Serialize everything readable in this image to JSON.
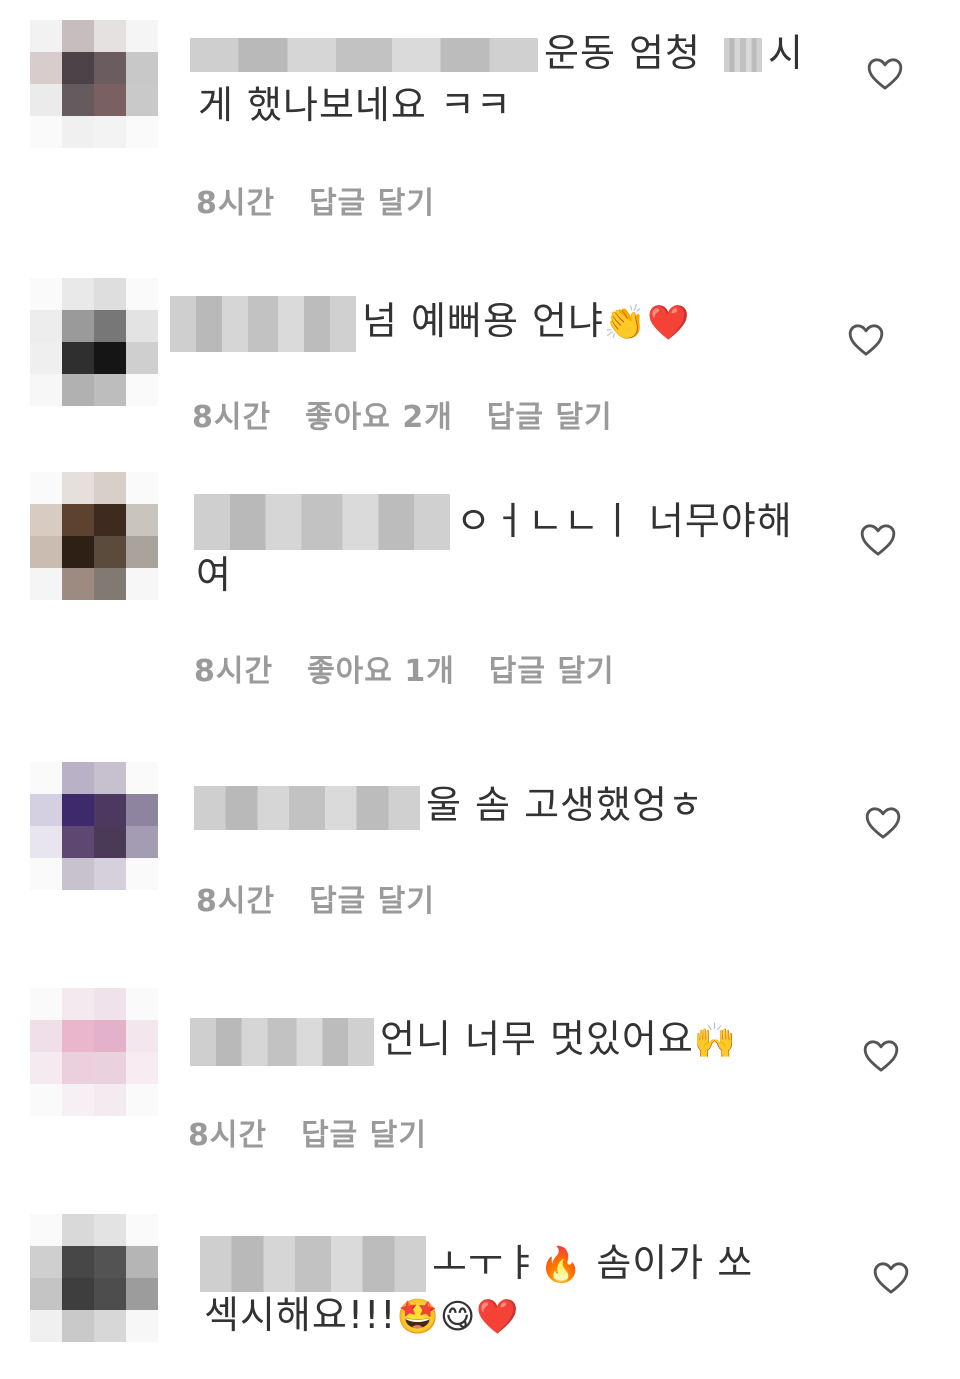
{
  "comments": [
    {
      "text_line1": "운동 엄청",
      "text_line1b": "시",
      "text_line2": "게 했나보네요 ㅋㅋ",
      "time": "8시간",
      "reply": "답글 달기",
      "avatar": [
        "#f2f2f2",
        "#c8bdbe",
        "#e6e1e1",
        "#f5f5f5",
        "#d9cccd",
        "#4d4248",
        "#6a5c5f",
        "#c8c8c8",
        "#ebebeb",
        "#655a5d",
        "#7b6061",
        "#c9c9c9",
        "#fafafa",
        "#f0f0f0",
        "#f3f3f3",
        "#fafafa"
      ]
    },
    {
      "text": "넘 예뻐용 언냐",
      "emojis": "👏❤️",
      "time": "8시간",
      "likes": "좋아요 2개",
      "reply": "답글 달기",
      "avatar": [
        "#fafafa",
        "#e9e9e9",
        "#dedede",
        "#fafafa",
        "#ededed",
        "#9a9a9a",
        "#777777",
        "#e3e3e3",
        "#efefef",
        "#2f2f2f",
        "#151515",
        "#cfcfcf",
        "#f7f7f7",
        "#b1b1b1",
        "#bdbdbd",
        "#fafafa"
      ]
    },
    {
      "text_line1": "ㅇㅓㄴㄴㅣ 너무야해",
      "text_line2": "여",
      "time": "8시간",
      "likes": "좋아요 1개",
      "reply": "답글 달기",
      "avatar": [
        "#fafafa",
        "#e6e0dc",
        "#d8cfc8",
        "#fafafa",
        "#d8cbc2",
        "#5e4230",
        "#3f2a1f",
        "#c9c4bd",
        "#cbbcb1",
        "#2f2016",
        "#5b4b3d",
        "#a9a39c",
        "#f5f5f5",
        "#9d8a80",
        "#817a73",
        "#f7f7f7"
      ]
    },
    {
      "text": "울 솜 고생했엉ㅎ",
      "time": "8시간",
      "reply": "답글 달기",
      "avatar": [
        "#fafafa",
        "#b9b2c7",
        "#c7c0cf",
        "#fafafa",
        "#d4cfe1",
        "#3d2a6c",
        "#4d3960",
        "#8e84a0",
        "#e9e5ee",
        "#5e4872",
        "#4a3a57",
        "#a49cb2",
        "#fafafa",
        "#c8c1ce",
        "#d6d0dc",
        "#fafafa"
      ]
    },
    {
      "text": "언니 너무 멋있어요",
      "emojis": "🙌",
      "time": "8시간",
      "reply": "답글 달기",
      "avatar": [
        "#fafafa",
        "#f4e9ef",
        "#f0e2ea",
        "#fafafa",
        "#f0dfe8",
        "#e9b6cc",
        "#e3b1c9",
        "#f3e6ec",
        "#f5eaf0",
        "#ebcfdc",
        "#ead1de",
        "#f6ecf1",
        "#fafafa",
        "#f6eff3",
        "#f4ebf0",
        "#fafafa"
      ]
    },
    {
      "text_line1": "ㅗㅜㅑ",
      "emoji1": "🔥",
      "text_line1b": "솜이가 쏘",
      "text_line2": "섹시해요!!!",
      "emojis2": "🤩😋❤️",
      "avatar": [
        "#fafafa",
        "#d9d9d9",
        "#e3e3e3",
        "#fafafa",
        "#cfcfcf",
        "#474747",
        "#535353",
        "#b5b5b5",
        "#c4c4c4",
        "#3e3e3e",
        "#4d4d4d",
        "#9c9c9c",
        "#f0f0f0",
        "#c9c9c9",
        "#d7d7d7",
        "#f7f7f7"
      ]
    }
  ],
  "icons": {
    "like": "heart-outline-icon"
  },
  "colors": {
    "text": "#333333",
    "meta": "#9a9a9a",
    "heart_stroke": "#555555"
  }
}
